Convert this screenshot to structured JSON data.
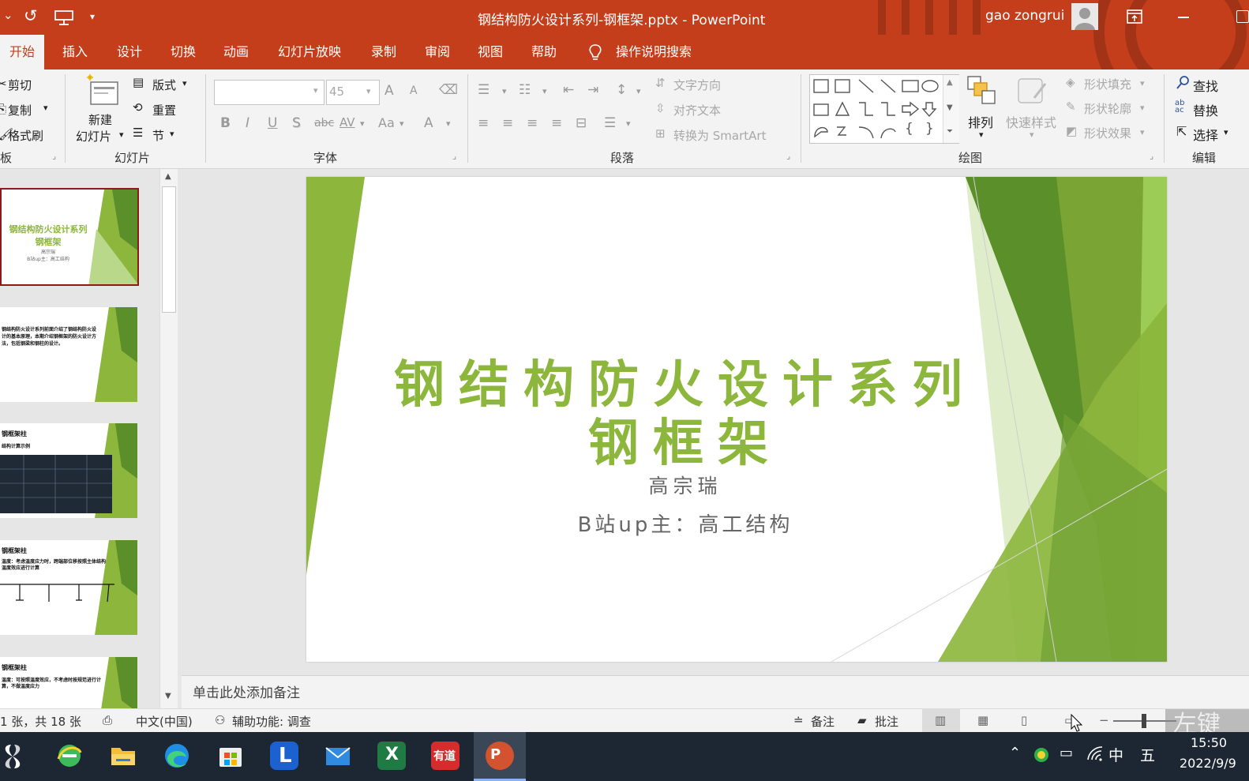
{
  "titlebar": {
    "document_title": "钢结构防火设计系列-钢框架.pptx  -  PowerPoint",
    "user_name": "gao zongrui",
    "qat_dropdown": "▾"
  },
  "tabs": [
    {
      "label": "开始",
      "active": true
    },
    {
      "label": "插入"
    },
    {
      "label": "设计"
    },
    {
      "label": "切换"
    },
    {
      "label": "动画"
    },
    {
      "label": "幻灯片放映"
    },
    {
      "label": "录制"
    },
    {
      "label": "审阅"
    },
    {
      "label": "视图"
    },
    {
      "label": "帮助"
    }
  ],
  "tell_me": "操作说明搜索",
  "ribbon": {
    "clipboard": {
      "cut": "剪切",
      "copy": "复制",
      "format_painter": "格式刷",
      "group": "板"
    },
    "slides": {
      "new_slide_1": "新建",
      "new_slide_2": "幻灯片",
      "layout": "版式",
      "reset": "重置",
      "section": "节",
      "group": "幻灯片"
    },
    "font": {
      "size_value": "45",
      "buttons": {
        "bold": "B",
        "italic": "I",
        "underline": "U",
        "shadow": "S",
        "strike": "abc",
        "spacing": "AV",
        "case": "Aa",
        "color": "A",
        "grow": "A",
        "shrink": "A"
      },
      "group": "字体"
    },
    "paragraph": {
      "text_direction": "文字方向",
      "align_text": "对齐文本",
      "smartart": "转换为 SmartArt",
      "group": "段落"
    },
    "drawing": {
      "arrange": "排列",
      "quick_styles": "快速样式",
      "shape_fill": "形状填充",
      "shape_outline": "形状轮廓",
      "shape_effects": "形状效果",
      "group": "绘图",
      "shape_glyphs": {
        "brace_left": "{",
        "brace_right": "}"
      }
    },
    "editing": {
      "find": "查找",
      "replace": "替换",
      "select": "选择",
      "group": "编辑",
      "replace_icon_text": "ab\nac"
    }
  },
  "thumbnails": [
    {
      "title": "钢结构防火设计系列",
      "subtitle": "钢框架",
      "line3": "高宗瑞",
      "line4": "B站up主：高工结构"
    },
    {
      "text": "钢结构防火设计系列前面介绍了钢结构防火设计的基本原理，本期介绍钢框架的防火设计方法，包括钢梁和钢柱的设计。"
    },
    {
      "heading": "钢框架柱",
      "sub": "结构计算示例"
    },
    {
      "heading": "钢框架柱",
      "sub": "温度：考虑温度应力时，跨端部位移按照主体结构温度效应进行计算"
    },
    {
      "heading": "钢框架柱",
      "sub": "温度：可按照温度效应，不考虑时按规范进行计算，不做温度应力"
    }
  ],
  "slide": {
    "title_line1": "钢结构防火设计系列",
    "title_line2": "钢框架",
    "author": "高宗瑞",
    "channel": "B站up主：高工结构",
    "colors": {
      "accent": "#8cb63c",
      "dark_green": "#5a8f29",
      "light_green": "#b9d889"
    }
  },
  "notes": {
    "placeholder": "单击此处添加备注"
  },
  "statusbar": {
    "slide_count": "1 张，共 18 张",
    "language": "中文(中国)",
    "accessibility": "辅助功能: 调查",
    "notes_btn": "备注",
    "comments_btn": "批注",
    "zoom_minus": "−",
    "watermark": "左键"
  },
  "taskbar": {
    "time": "15:50",
    "date": "2022/9/9",
    "ime_lang": "中",
    "ime_mode": "五",
    "excel_letter": "X",
    "youdao_label": "有道",
    "ppt_letter": "P",
    "lenovo_letter": "L"
  }
}
